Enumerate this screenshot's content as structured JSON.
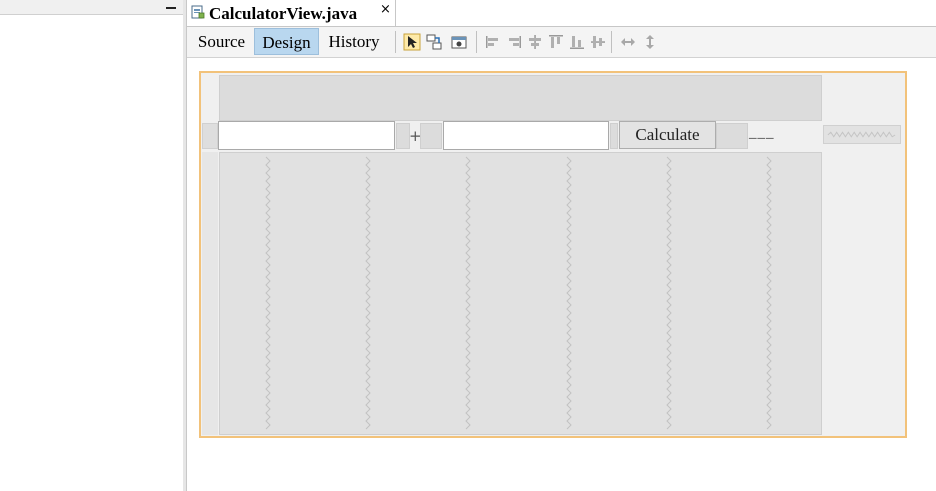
{
  "editor": {
    "file_tab": {
      "title": "CalculatorView.java",
      "close_glyph": "×"
    },
    "view_tabs": [
      {
        "id": "source",
        "label": "Source",
        "active": false
      },
      {
        "id": "design",
        "label": "Design",
        "active": true
      },
      {
        "id": "history",
        "label": "History",
        "active": false
      }
    ],
    "toolbar_icons": [
      "selection-mode-icon",
      "connection-mode-icon",
      "preview-design-icon",
      "align-left-icon",
      "align-right-icon",
      "center-horizontally-icon",
      "align-top-icon",
      "align-bottom-icon",
      "center-vertically-icon",
      "resize-width-icon",
      "resize-height-icon"
    ]
  },
  "form": {
    "plus_label": "+",
    "calculate_button": "Calculate",
    "result_label": "___",
    "field_a_value": "",
    "field_b_value": ""
  },
  "colors": {
    "design_tab_active": "#b9d7ef",
    "canvas_border": "#f2c27a",
    "canvas_bg": "#f0f0f0"
  }
}
